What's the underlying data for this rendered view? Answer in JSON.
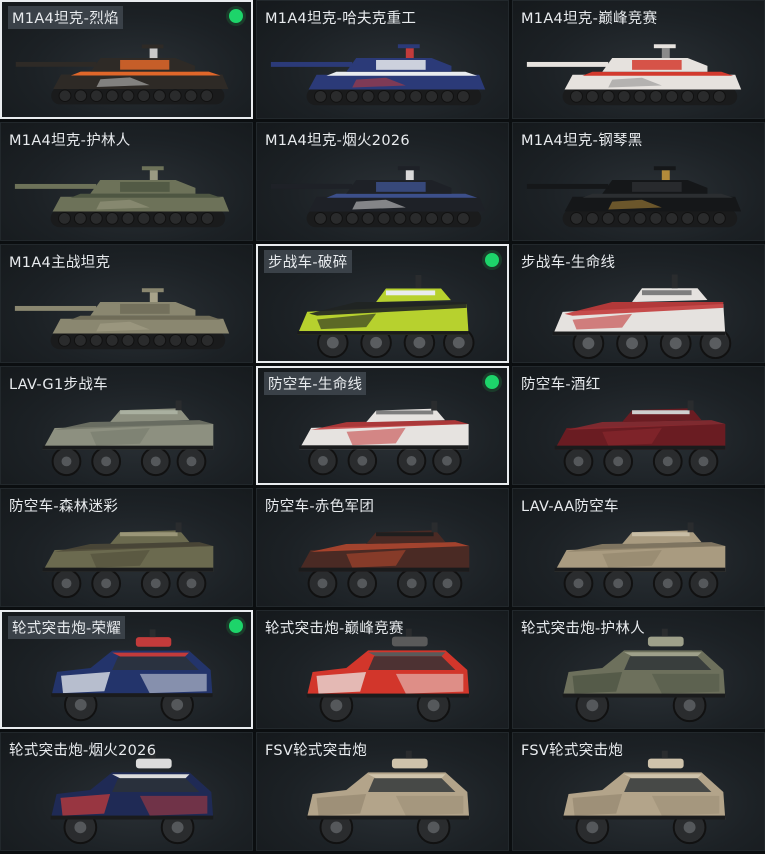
{
  "cards": [
    {
      "label": "M1A4坦克-烈焰",
      "type": "tank",
      "selected": true,
      "checked": true,
      "hl": true,
      "body": "#2e2a26",
      "accent": "#e0672a",
      "accent2": "#c9c9c9"
    },
    {
      "label": "M1A4坦克-哈夫克重工",
      "type": "tank",
      "selected": false,
      "checked": false,
      "hl": false,
      "body": "#2b3a78",
      "accent": "#e9ecef",
      "accent2": "#c23b3b"
    },
    {
      "label": "M1A4坦克-巅峰竞赛",
      "type": "tank",
      "selected": false,
      "checked": false,
      "hl": false,
      "body": "#e6e2de",
      "accent": "#d23a2e",
      "accent2": "#8a8a8a"
    },
    {
      "label": "M1A4坦克-护林人",
      "type": "tank",
      "selected": false,
      "checked": false,
      "hl": false,
      "body": "#6d7259",
      "accent": "#4e5642",
      "accent2": "#9a9a82"
    },
    {
      "label": "M1A4坦克-烟火2026",
      "type": "tank",
      "selected": false,
      "checked": false,
      "hl": false,
      "body": "#1e2127",
      "accent": "#3c4f8a",
      "accent2": "#d9d9d9"
    },
    {
      "label": "M1A4坦克-钢琴黑",
      "type": "tank",
      "selected": false,
      "checked": false,
      "hl": false,
      "body": "#151719",
      "accent": "#2b2e31",
      "accent2": "#b38a3a"
    },
    {
      "label": "M1A4主战坦克",
      "type": "tank",
      "selected": false,
      "checked": false,
      "hl": false,
      "body": "#8a8770",
      "accent": "#6f6c58",
      "accent2": "#a8a38a"
    },
    {
      "label": "步战车-破碎",
      "type": "ifv",
      "selected": true,
      "checked": true,
      "hl": true,
      "body": "#b7d12e",
      "accent": "#202322",
      "accent2": "#e9ecef"
    },
    {
      "label": "步战车-生命线",
      "type": "ifv",
      "selected": false,
      "checked": false,
      "hl": false,
      "body": "#e5e2df",
      "accent": "#c23b3b",
      "accent2": "#7e7e7e"
    },
    {
      "label": "LAV-G1步战车",
      "type": "lav",
      "selected": false,
      "checked": false,
      "hl": false,
      "body": "#8d9080",
      "accent": "#74786a",
      "accent2": "#aab0a0"
    },
    {
      "label": "防空车-生命线",
      "type": "lav",
      "selected": true,
      "checked": true,
      "hl": true,
      "body": "#e6e3e0",
      "accent": "#c23b3b",
      "accent2": "#7e7e7e"
    },
    {
      "label": "防空车-酒红",
      "type": "lav",
      "selected": false,
      "checked": false,
      "hl": false,
      "body": "#6a1c22",
      "accent": "#8e2a30",
      "accent2": "#cfcfcf"
    },
    {
      "label": "防空车-森林迷彩",
      "type": "lav",
      "selected": false,
      "checked": false,
      "hl": false,
      "body": "#6b6a4f",
      "accent": "#4f4a38",
      "accent2": "#9a9678"
    },
    {
      "label": "防空车-赤色军团",
      "type": "lav",
      "selected": false,
      "checked": false,
      "hl": false,
      "body": "#4a2a24",
      "accent": "#b8482e",
      "accent2": "#1e1e1e"
    },
    {
      "label": "LAV-AA防空车",
      "type": "lav",
      "selected": false,
      "checked": false,
      "hl": false,
      "body": "#a99b80",
      "accent": "#8e8168",
      "accent2": "#c8bda5"
    },
    {
      "label": "轮式突击炮-荣耀",
      "type": "car",
      "selected": true,
      "checked": true,
      "hl": true,
      "body": "#23346b",
      "accent": "#e9ecef",
      "accent2": "#c23b3b"
    },
    {
      "label": "轮式突击炮-巅峰竞赛",
      "type": "car",
      "selected": false,
      "checked": false,
      "hl": false,
      "body": "#d2362b",
      "accent": "#e9e6e3",
      "accent2": "#5a5a5a"
    },
    {
      "label": "轮式突击炮-护林人",
      "type": "car",
      "selected": false,
      "checked": false,
      "hl": false,
      "body": "#6d705c",
      "accent": "#4e5443",
      "accent2": "#9ea08a"
    },
    {
      "label": "轮式突击炮-烟火2026",
      "type": "car",
      "selected": false,
      "checked": false,
      "hl": false,
      "body": "#1f2a55",
      "accent": "#c23b3b",
      "accent2": "#dcdcdc"
    },
    {
      "label": "FSV轮式突击炮",
      "type": "car",
      "selected": false,
      "checked": false,
      "hl": false,
      "body": "#b3a48a",
      "accent": "#978a72",
      "accent2": "#cfc3ab"
    },
    {
      "label": "FSV轮式突击炮",
      "type": "car",
      "selected": false,
      "checked": false,
      "hl": false,
      "body": "#b3a48a",
      "accent": "#978a72",
      "accent2": "#cfc3ab"
    }
  ]
}
